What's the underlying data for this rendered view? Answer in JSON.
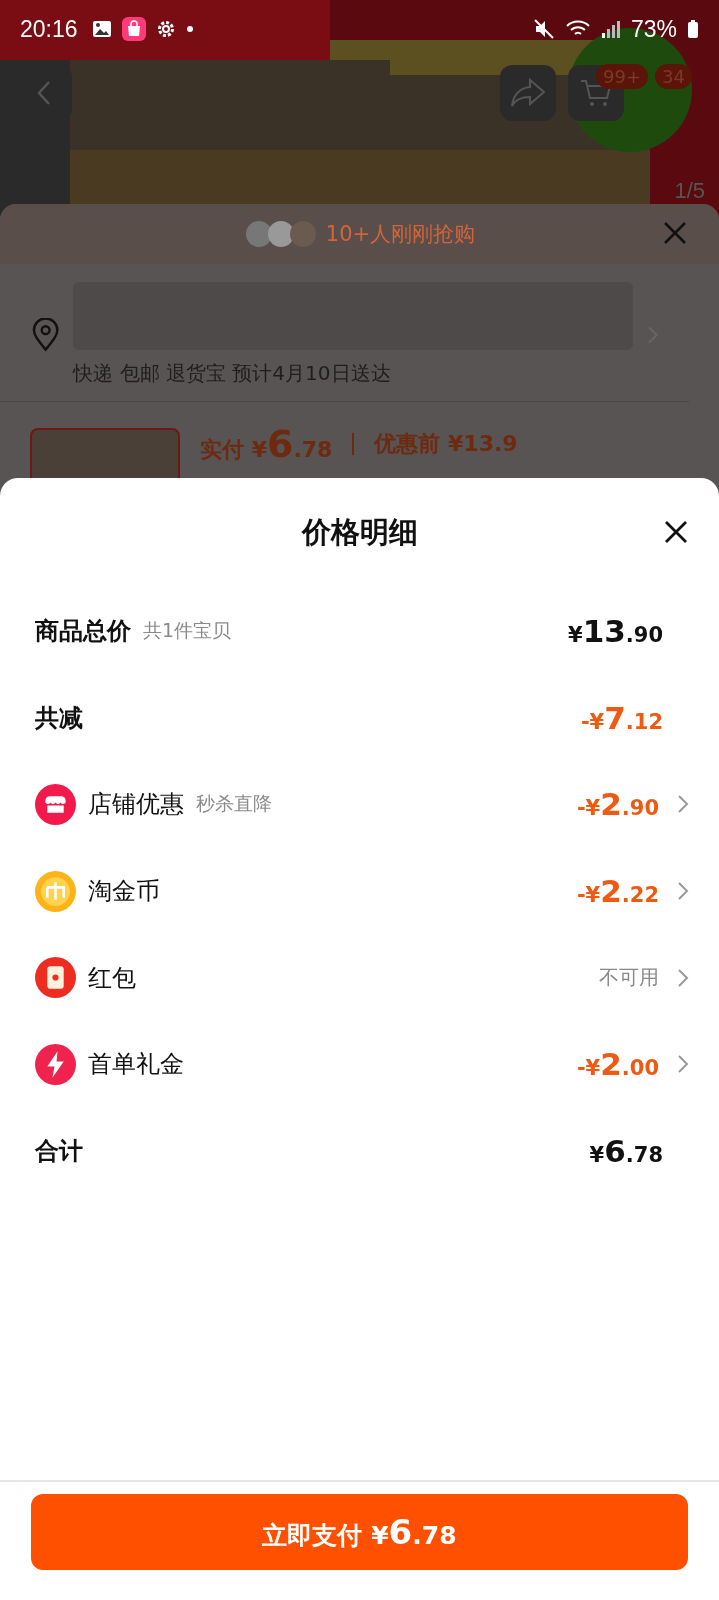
{
  "status_bar": {
    "time": "20:16",
    "battery": "73%"
  },
  "product_page": {
    "cart_badge": "99+",
    "message_badge": "34",
    "image_counter": "1/5"
  },
  "order_sheet": {
    "buyers_note": "10+人刚刚抢购",
    "delivery": "快递 包邮 退货宝 预计4月10日送达",
    "paid_label": "实付",
    "paid_amount": {
      "prefix": "¥",
      "main": "6",
      "fraction": ".78"
    },
    "before_label": "优惠前 ¥13.9"
  },
  "price_sheet": {
    "title": "价格明细",
    "rows": [
      {
        "kind": "summary",
        "label": "商品总价",
        "note": "共1件宝贝",
        "discount": false,
        "amount": {
          "prefix": "¥",
          "main": "13",
          "fraction": ".90"
        }
      },
      {
        "kind": "summary",
        "label": "共减",
        "discount": true,
        "amount": {
          "prefix": "-¥",
          "main": "7",
          "fraction": ".12"
        }
      },
      {
        "kind": "store",
        "label": "店铺优惠",
        "note": "秒杀直降",
        "discount": true,
        "amount": {
          "prefix": "-¥",
          "main": "2",
          "fraction": ".90"
        }
      },
      {
        "kind": "coin",
        "label": "淘金币",
        "discount": true,
        "amount": {
          "prefix": "-¥",
          "main": "2",
          "fraction": ".22"
        }
      },
      {
        "kind": "envelope",
        "label": "红包",
        "status": "不可用"
      },
      {
        "kind": "bolt",
        "label": "首单礼金",
        "discount": true,
        "amount": {
          "prefix": "-¥",
          "main": "2",
          "fraction": ".00"
        }
      },
      {
        "kind": "summary",
        "label": "合计",
        "discount": false,
        "amount": {
          "prefix": "¥",
          "main": "6",
          "fraction": ".78"
        }
      }
    ],
    "pay_button": {
      "label": "立即支付",
      "amount": {
        "prefix": "¥",
        "main": "6",
        "fraction": ".78"
      }
    }
  }
}
